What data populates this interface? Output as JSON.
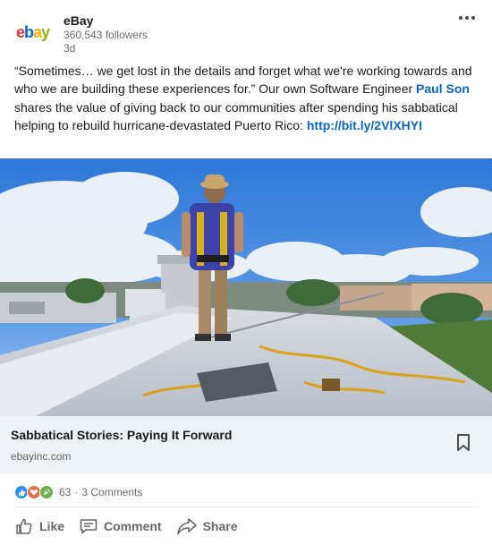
{
  "post": {
    "author": {
      "name": "eBay",
      "followers": "360,543 followers",
      "time": "3d",
      "logo_letters": [
        "e",
        "b",
        "a",
        "y"
      ]
    },
    "menu_icon": "more-horizontal-icon",
    "text": {
      "part1": "“Sometimes… we get lost in the details and forget what we're working towards and who we are building these experiences for.” Our own Software Engineer ",
      "mention": "Paul Son",
      "part2": " shares the value of giving back to our communities after spending his sabbatical helping to rebuild hurricane-devastated Puerto Rico: ",
      "link": "http://bit.ly/2VlXHYI"
    },
    "link_preview": {
      "title": "Sabbatical Stories: Paying It Forward",
      "source": "ebayinc.com",
      "bookmark_icon": "bookmark-icon"
    },
    "social": {
      "reactions": [
        "like-icon",
        "love-icon",
        "celebrate-icon"
      ],
      "reaction_count": "63",
      "separator": "·",
      "comments": "3 Comments"
    },
    "actions": [
      {
        "label": "Like",
        "icon": "thumbs-up-icon"
      },
      {
        "label": "Comment",
        "icon": "comment-icon"
      },
      {
        "label": "Share",
        "icon": "share-icon"
      }
    ]
  },
  "colors": {
    "link": "#0a66c2",
    "preview_bg": "#eef3f8",
    "logo_e": "#e53238",
    "logo_b": "#0064d2",
    "logo_a": "#f5af02",
    "logo_y": "#86b817"
  }
}
